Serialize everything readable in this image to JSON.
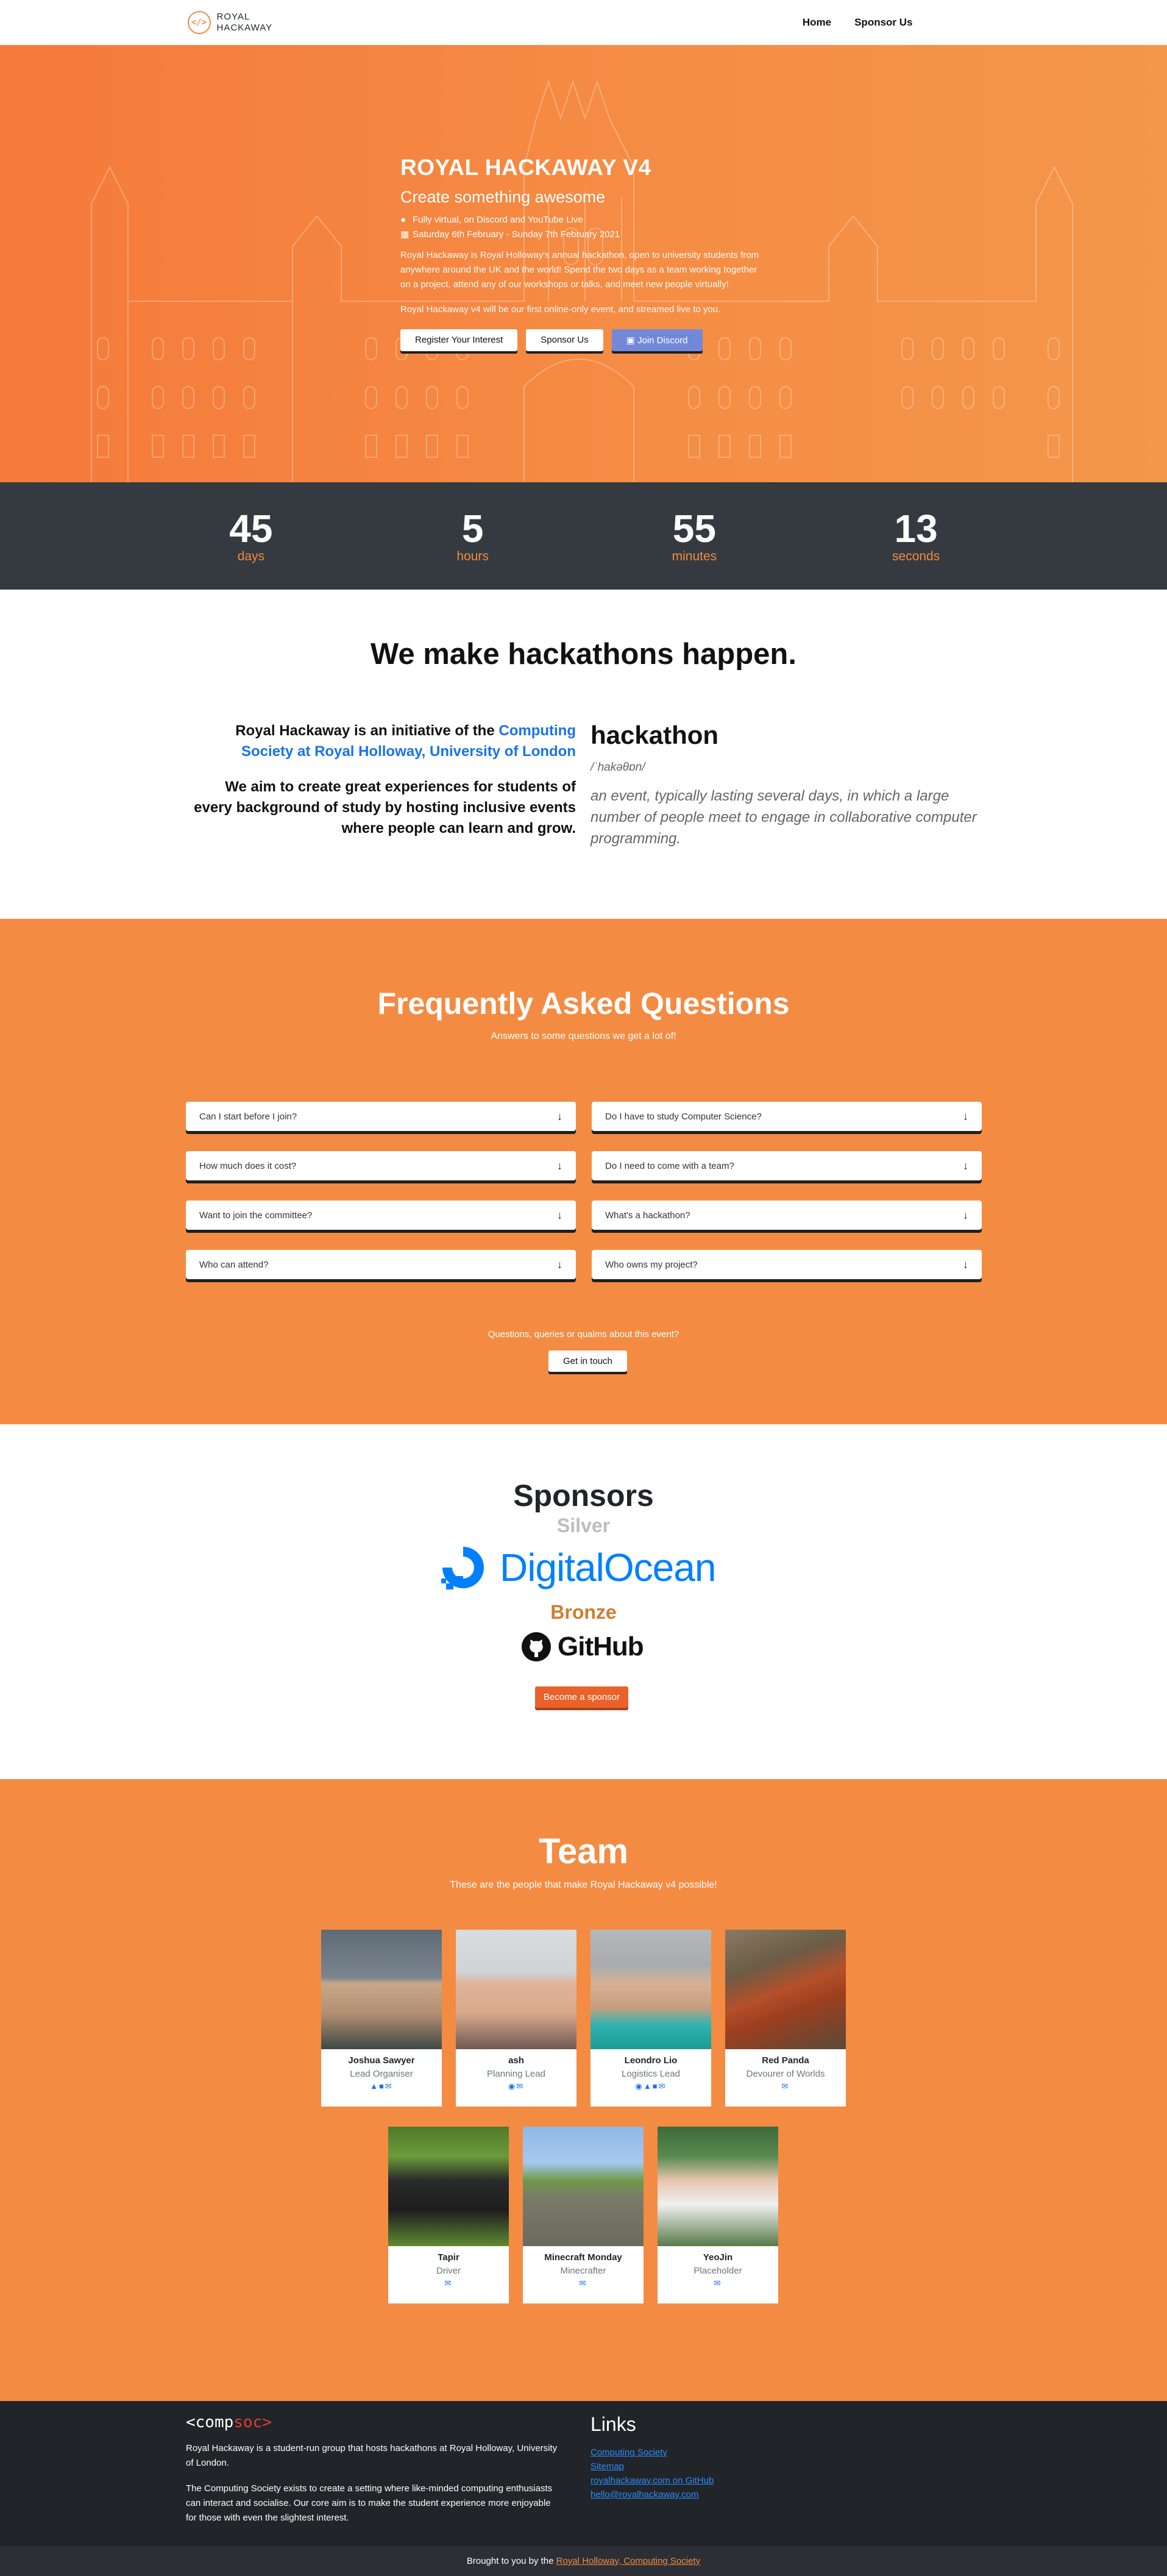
{
  "nav": {
    "brand_line1": "ROYAL",
    "brand_line2": "HACKAWAY",
    "brand_mark": "</>",
    "links": [
      "Home",
      "Sponsor Us"
    ]
  },
  "hero": {
    "title": "ROYAL HACKAWAY V4",
    "tagline": "Create something awesome",
    "location": "Fully virtual, on Discord and YouTube Live",
    "dates": "Saturday 6th February - Sunday 7th February 2021",
    "description": "Royal Hackaway is Royal Holloway's annual hackathon, open to university students from anywhere around the UK and the world! Spend the two days as a team working together on a project, attend any of our workshops or talks, and meet new people virtually!",
    "online_note": "Royal Hackaway v4 will be our first online-only event, and streamed live to you.",
    "buttons": {
      "register": "Register Your Interest",
      "sponsor": "Sponsor Us",
      "discord": "Join Discord"
    },
    "icons": {
      "location": "map-marker-icon",
      "dates": "calendar-icon",
      "discord": "discord-icon"
    }
  },
  "countdown": [
    {
      "value": "45",
      "label": "days"
    },
    {
      "value": "5",
      "label": "hours"
    },
    {
      "value": "55",
      "label": "minutes"
    },
    {
      "value": "13",
      "label": "seconds"
    }
  ],
  "about": {
    "heading": "We make hackathons happen.",
    "initiative_prefix": "Royal Hackaway is an initiative of the ",
    "initiative_link": "Computing Society at Royal Holloway, University of London",
    "aim": "We aim to create great experiences for students of every background of study by hosting inclusive events where people can learn and grow.",
    "word": "hackathon",
    "pronunciation": "/ˈhakəθɒn/",
    "definition": "an event, typically lasting several days, in which a large number of people meet to engage in collaborative computer programming."
  },
  "faq": {
    "heading": "Frequently Asked Questions",
    "subheading": "Answers to some questions we get a lot of!",
    "items": [
      "Can I start before I join?",
      "Do I have to study Computer Science?",
      "How much does it cost?",
      "Do I need to come with a team?",
      "Want to join the committee?",
      "What's a hackathon?",
      "Who can attend?",
      "Who owns my project?"
    ],
    "contact_prompt": "Questions, queries or qualms about this event?",
    "contact_button": "Get in touch"
  },
  "sponsors": {
    "heading": "Sponsors",
    "silver": "Silver",
    "silver_sponsor": "DigitalOcean",
    "bronze": "Bronze",
    "bronze_sponsor": "GitHub",
    "button": "Become a sponsor",
    "colors": {
      "silver": "#bdbdbd",
      "bronze": "#cd7f32",
      "digitalocean": "#0080ff"
    }
  },
  "team": {
    "heading": "Team",
    "subheading": "These are the people that make Royal Hackaway v4 possible!",
    "members": [
      {
        "name": "Joshua Sawyer",
        "role": "Lead Organiser",
        "icons": "twitter-icon linkedin-icon email-icon"
      },
      {
        "name": "ash",
        "role": "Planning Lead",
        "icons": "github-icon email-icon"
      },
      {
        "name": "Leondro Lio",
        "role": "Logistics Lead",
        "icons": "github-icon twitter-icon linkedin-icon email-icon"
      },
      {
        "name": "Red Panda",
        "role": "Devourer of Worlds",
        "icons": "email-icon"
      },
      {
        "name": "Tapir",
        "role": "Driver",
        "icons": "email-icon"
      },
      {
        "name": "Minecraft Monday",
        "role": "Minecrafter",
        "icons": "email-icon"
      },
      {
        "name": "YeoJin",
        "role": "Placeholder",
        "icons": "email-icon"
      }
    ]
  },
  "footer": {
    "logo_a": "<comp",
    "logo_b": "soc>",
    "about1": "Royal Hackaway is a student-run group that hosts hackathons at Royal Holloway, University of London.",
    "about2": "The Computing Society exists to create a setting where like-minded computing enthusiasts can interact and socialise. Our core aim is to make the student experience more enjoyable for those with even the slightest interest.",
    "links_heading": "Links",
    "links": [
      "Computing Society",
      "Sitemap",
      "royalhackaway.com on GitHub",
      "hello@royalhackaway.com"
    ],
    "credit_prefix": "Brought to you by the ",
    "credit_link": "Royal Holloway, Computing Society"
  }
}
